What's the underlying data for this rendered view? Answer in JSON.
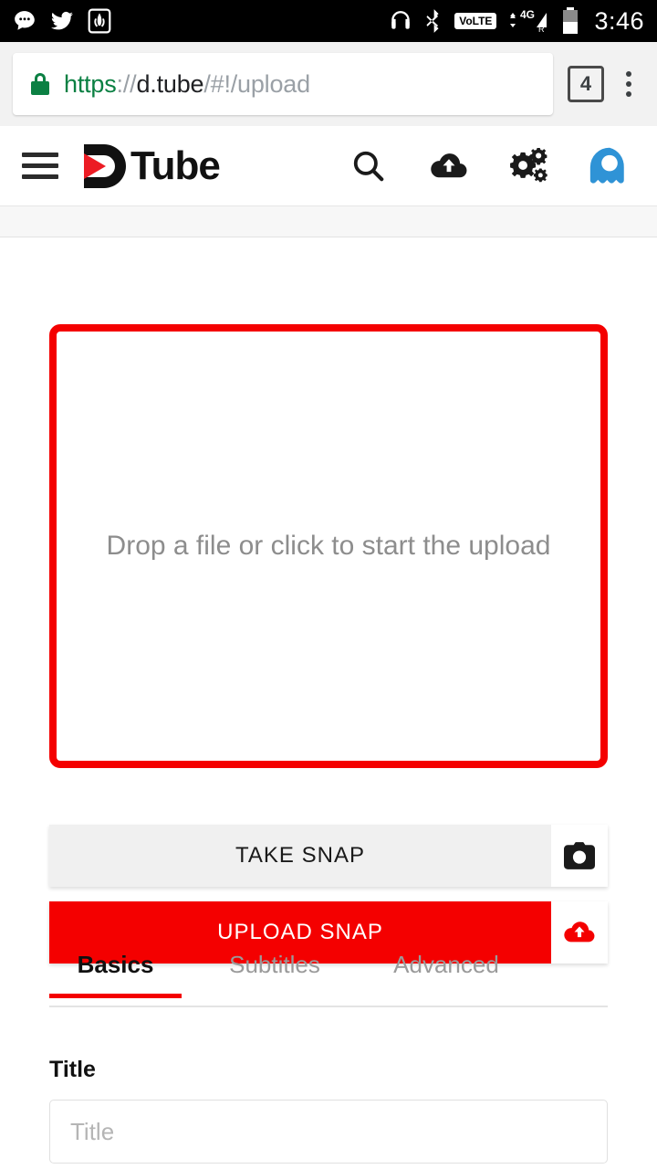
{
  "statusbar": {
    "left_icons": [
      {
        "name": "messages-icon",
        "glyph": "speech-bubble"
      },
      {
        "name": "twitter-icon",
        "glyph": "bird"
      },
      {
        "name": "app-badge-icon",
        "glyph": "boxed-leaf"
      }
    ],
    "right_icons": [
      {
        "name": "headphones-icon",
        "glyph": "headphones"
      },
      {
        "name": "bluetooth-icon",
        "glyph": "bluetooth"
      }
    ],
    "volte_label": "VoLTE",
    "network_label": "4G",
    "roaming_label": "R",
    "time": "3:46"
  },
  "browser": {
    "url": {
      "scheme": "https",
      "separator": "://",
      "host": "d.tube",
      "path": "/#!/upload"
    },
    "lock_icon": "secure-lock-icon",
    "tab_count": "4",
    "menu_icon": "overflow-menu-icon"
  },
  "app_header": {
    "menu_icon": "hamburger-menu-icon",
    "logo_text": "Tube",
    "actions": [
      {
        "name": "search-icon",
        "label": "Search"
      },
      {
        "name": "upload-cloud-icon",
        "label": "Upload"
      },
      {
        "name": "settings-gears-icon",
        "label": "Settings"
      },
      {
        "name": "avatar-icon",
        "label": "Account"
      }
    ],
    "accent_color": "#ec1c24",
    "avatar_color": "#2f93d6"
  },
  "upload_page": {
    "dropzone_text": "Drop a file or click to start the upload",
    "dropzone_border_color": "#f40000",
    "take_snap_label": "TAKE SNAP",
    "take_snap_icon": "camera-icon",
    "upload_snap_label": "UPLOAD SNAP",
    "upload_snap_icon": "cloud-upload-icon",
    "upload_snap_color": "#f40000",
    "tabs": [
      {
        "label": "Basics",
        "active": true
      },
      {
        "label": "Subtitles",
        "active": false
      },
      {
        "label": "Advanced",
        "active": false
      }
    ],
    "title_field": {
      "label": "Title",
      "placeholder": "Title",
      "value": ""
    }
  }
}
